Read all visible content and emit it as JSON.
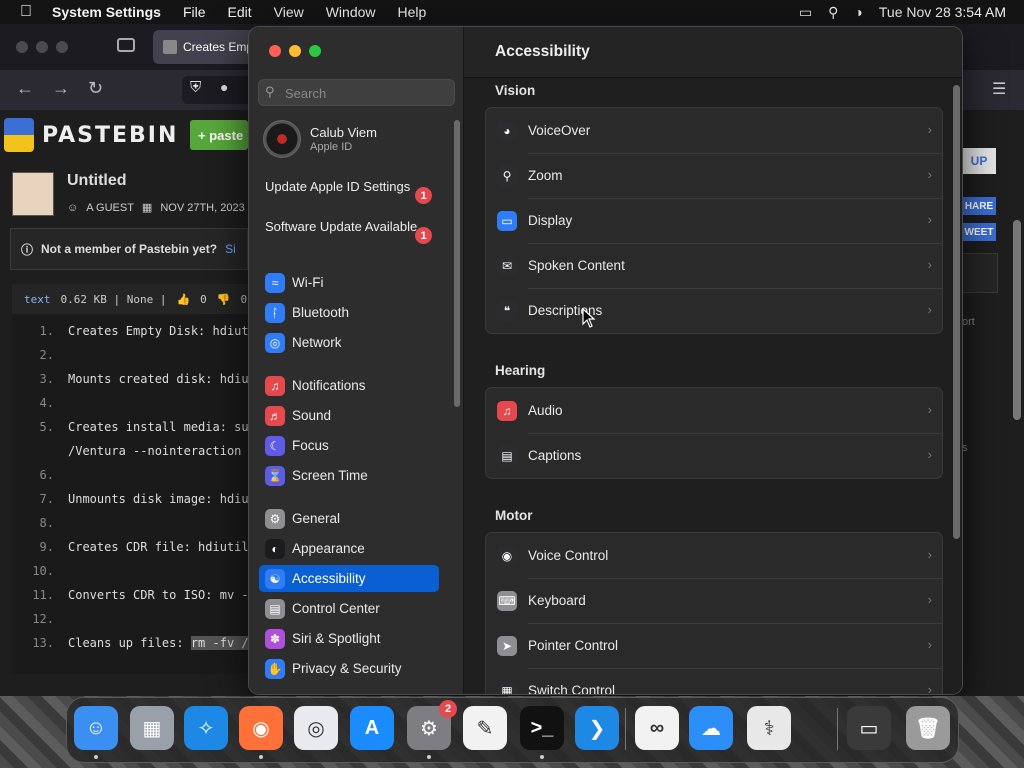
{
  "menubar": {
    "app": "System Settings",
    "items": [
      "File",
      "Edit",
      "View",
      "Window",
      "Help"
    ],
    "datetime": "Tue Nov 28  3:54 AM"
  },
  "browser": {
    "tab_title": "Creates Emp",
    "logo_text": "PASTEBIN",
    "paste_button": "paste",
    "signup_button": "UP",
    "share_button": "HARE",
    "tweet_button": "WEET",
    "paste_title": "Untitled",
    "author": "A GUEST",
    "date": "NOV 27TH, 2023",
    "notice": "Not a member of Pastebin yet?",
    "notice_link": "Si",
    "code_lang": "text",
    "code_meta": "0.62 KB | None |",
    "likes": "0",
    "dislikes": "0",
    "right_text_1": "ort",
    "right_text_2": "s",
    "code_lines": [
      {
        "n": "1.",
        "t": "Creates Empty Disk: hdiut"
      },
      {
        "n": "2.",
        "t": ""
      },
      {
        "n": "3.",
        "t": "Mounts created disk: hdiu"
      },
      {
        "n": "4.",
        "t": ""
      },
      {
        "n": "5.",
        "t": "Creates install media: su"
      },
      {
        "n": "",
        "t": "/Ventura --nointeraction"
      },
      {
        "n": "6.",
        "t": ""
      },
      {
        "n": "7.",
        "t": "Unmounts disk image: hdiu"
      },
      {
        "n": "8.",
        "t": ""
      },
      {
        "n": "9.",
        "t": "Creates CDR file: hdiutil"
      },
      {
        "n": "10.",
        "t": ""
      },
      {
        "n": "11.",
        "t": "Converts CDR to ISO: mv -"
      },
      {
        "n": "12.",
        "t": ""
      },
      {
        "n": "13.",
        "t": "Cleans up files: ",
        "hl": "rm -fv /"
      }
    ]
  },
  "settings": {
    "search_placeholder": "Search",
    "user": {
      "name": "Calub Viem",
      "subtitle": "Apple ID"
    },
    "updates": [
      {
        "label": "Update Apple ID Settings",
        "badge": "1"
      },
      {
        "label": "Software Update Available",
        "badge": "1"
      }
    ],
    "sidebar": [
      {
        "label": "Wi-Fi",
        "icon": "wifi-icon",
        "color": "#2f7cf6"
      },
      {
        "label": "Bluetooth",
        "icon": "bluetooth-icon",
        "color": "#2f7cf6"
      },
      {
        "label": "Network",
        "icon": "globe-icon",
        "color": "#2f7cf6"
      },
      {
        "label": "Notifications",
        "icon": "bell-icon",
        "color": "#e5484d"
      },
      {
        "label": "Sound",
        "icon": "speaker-icon",
        "color": "#e5484d"
      },
      {
        "label": "Focus",
        "icon": "moon-icon",
        "color": "#5e5ce6"
      },
      {
        "label": "Screen Time",
        "icon": "hourglass-icon",
        "color": "#5e5ce6"
      },
      {
        "label": "General",
        "icon": "gear-icon",
        "color": "#8e8e93"
      },
      {
        "label": "Appearance",
        "icon": "appearance-icon",
        "color": "#1c1c1e"
      },
      {
        "label": "Accessibility",
        "icon": "accessibility-icon",
        "color": "#2f7cf6",
        "selected": true
      },
      {
        "label": "Control Center",
        "icon": "control-center-icon",
        "color": "#8e8e93"
      },
      {
        "label": "Siri & Spotlight",
        "icon": "siri-icon",
        "color": "#b04fdc"
      },
      {
        "label": "Privacy & Security",
        "icon": "hand-icon",
        "color": "#2f7cf6"
      }
    ],
    "title": "Accessibility",
    "sections": [
      {
        "heading": "Vision",
        "rows": [
          {
            "label": "VoiceOver",
            "icon": "voiceover-icon",
            "color": "#2c2c2e"
          },
          {
            "label": "Zoom",
            "icon": "zoom-icon",
            "color": "#2c2c2e"
          },
          {
            "label": "Display",
            "icon": "display-icon",
            "color": "#2f7cf6"
          },
          {
            "label": "Spoken Content",
            "icon": "speech-bubble-icon",
            "color": "#2c2c2e"
          },
          {
            "label": "Descriptions",
            "icon": "quote-bubble-icon",
            "color": "#2c2c2e"
          }
        ]
      },
      {
        "heading": "Hearing",
        "rows": [
          {
            "label": "Audio",
            "icon": "audio-icon",
            "color": "#e5484d"
          },
          {
            "label": "Captions",
            "icon": "captions-icon",
            "color": "#2c2c2e"
          }
        ]
      },
      {
        "heading": "Motor",
        "rows": [
          {
            "label": "Voice Control",
            "icon": "voice-control-icon",
            "color": "#2c2c2e"
          },
          {
            "label": "Keyboard",
            "icon": "keyboard-icon",
            "color": "#8e8e93"
          },
          {
            "label": "Pointer Control",
            "icon": "pointer-icon",
            "color": "#8e8e93"
          },
          {
            "label": "Switch Control",
            "icon": "switch-control-icon",
            "color": "#2c2c2e"
          }
        ]
      }
    ]
  },
  "dock": {
    "apps": [
      {
        "name": "finder-icon",
        "color": "#3a8ff0",
        "glyph": "☺",
        "running": true
      },
      {
        "name": "launchpad-icon",
        "color": "#9aa0aa",
        "glyph": "▦"
      },
      {
        "name": "safari-icon",
        "color": "#1e88e5",
        "glyph": "✧"
      },
      {
        "name": "firefox-icon",
        "color": "#ff7139",
        "glyph": "◉",
        "running": true
      },
      {
        "name": "chrome-icon",
        "color": "#e8eaed",
        "glyph": "◎"
      },
      {
        "name": "app-store-icon",
        "color": "#1a8cff",
        "glyph": "A"
      },
      {
        "name": "system-settings-icon",
        "color": "#7d7d82",
        "glyph": "⚙",
        "badge": "2",
        "running": true
      },
      {
        "name": "textedit-icon",
        "color": "#f2f2f2",
        "glyph": "✎"
      },
      {
        "name": "terminal-icon",
        "color": "#111111",
        "glyph": ">_",
        "running": true
      },
      {
        "name": "vscode-icon",
        "color": "#1e88e5",
        "glyph": "❯"
      },
      {
        "name": "visual-studio-icon",
        "color": "#f2f2f2",
        "glyph": "∞"
      },
      {
        "name": "onedrive-icon",
        "color": "#2c8ef8",
        "glyph": "☁"
      },
      {
        "name": "disk-utility-icon",
        "color": "#e8e8e8",
        "glyph": "⚕"
      },
      {
        "name": "downloads-stack-icon",
        "color": "#3a3a3a",
        "glyph": "▭"
      },
      {
        "name": "trash-icon",
        "color": "#9a9a9a",
        "glyph": "🗑"
      }
    ]
  }
}
